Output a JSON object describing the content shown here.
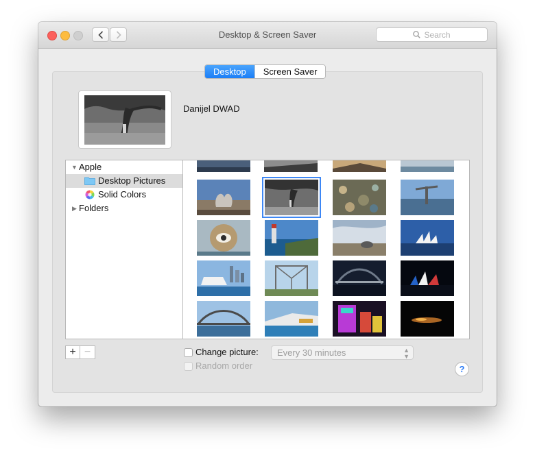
{
  "window": {
    "title": "Desktop & Screen Saver"
  },
  "search": {
    "placeholder": "Search"
  },
  "tabs": [
    {
      "label": "Desktop",
      "active": true
    },
    {
      "label": "Screen Saver",
      "active": false
    }
  ],
  "current_picture": {
    "name": "Danijel DWAD"
  },
  "sidebar": {
    "items": [
      {
        "label": "Apple",
        "expanded": true
      },
      {
        "label": "Desktop Pictures",
        "selected": true,
        "icon": "folder-icon"
      },
      {
        "label": "Solid Colors",
        "icon": "color-wheel-icon"
      },
      {
        "label": "Folders",
        "expanded": false
      }
    ]
  },
  "controls": {
    "add_label": "+",
    "remove_label": "−",
    "change_picture_label": "Change picture:",
    "interval_value": "Every 30 minutes",
    "random_order_label": "Random order",
    "help_label": "?"
  },
  "colors": {
    "accent": "#1b7ef7",
    "selection": "#3d87f5"
  }
}
